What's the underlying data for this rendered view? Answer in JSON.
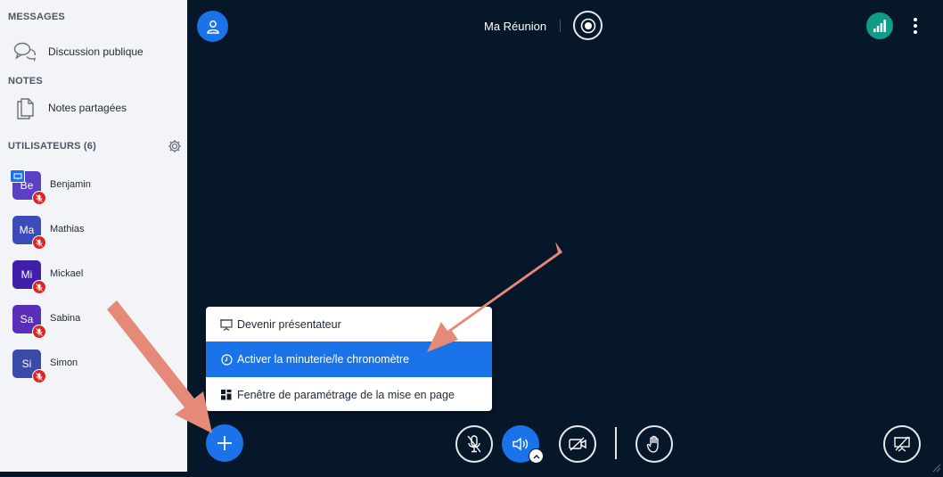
{
  "sidebar": {
    "messages_title": "MESSAGES",
    "public_chat": "Discussion publique",
    "notes_title": "NOTES",
    "shared_notes": "Notes partagées",
    "users_title": "UTILISATEURS (6)",
    "users": [
      {
        "initials": "Be",
        "name": "Benjamin",
        "color": "#5b3fc4"
      },
      {
        "initials": "Ma",
        "name": "Mathias",
        "color": "#3b4cb8"
      },
      {
        "initials": "Mi",
        "name": "Mickael",
        "color": "#3f1fa8"
      },
      {
        "initials": "Sa",
        "name": "Sabina",
        "color": "#5a2fb8"
      },
      {
        "initials": "Si",
        "name": "Simon",
        "color": "#3a4aa8"
      }
    ]
  },
  "header": {
    "meeting_title": "Ma Réunion"
  },
  "actions_menu": {
    "items": [
      {
        "label": "Devenir présentateur",
        "icon": "presentation-icon",
        "active": false
      },
      {
        "label": "Activer la minuterie/le chronomètre",
        "icon": "clock-icon",
        "active": true
      },
      {
        "label": "Fenêtre de paramétrage de la mise en page",
        "icon": "layout-icon",
        "active": false
      }
    ]
  },
  "colors": {
    "accent": "#1a73e8",
    "background": "#06172a",
    "sidebar": "#f2f4f7",
    "connection": "#0f9d8a",
    "muted_badge": "#dc2626",
    "annotation_arrow": "#e58a78"
  },
  "icons": [
    "chat-icon",
    "notes-icon",
    "gear-icon",
    "user-icon",
    "record-icon",
    "signal-icon",
    "kebab-icon",
    "plus-icon",
    "mic-off-icon",
    "speaker-icon",
    "video-off-icon",
    "raise-hand-icon",
    "screen-share-off-icon"
  ]
}
